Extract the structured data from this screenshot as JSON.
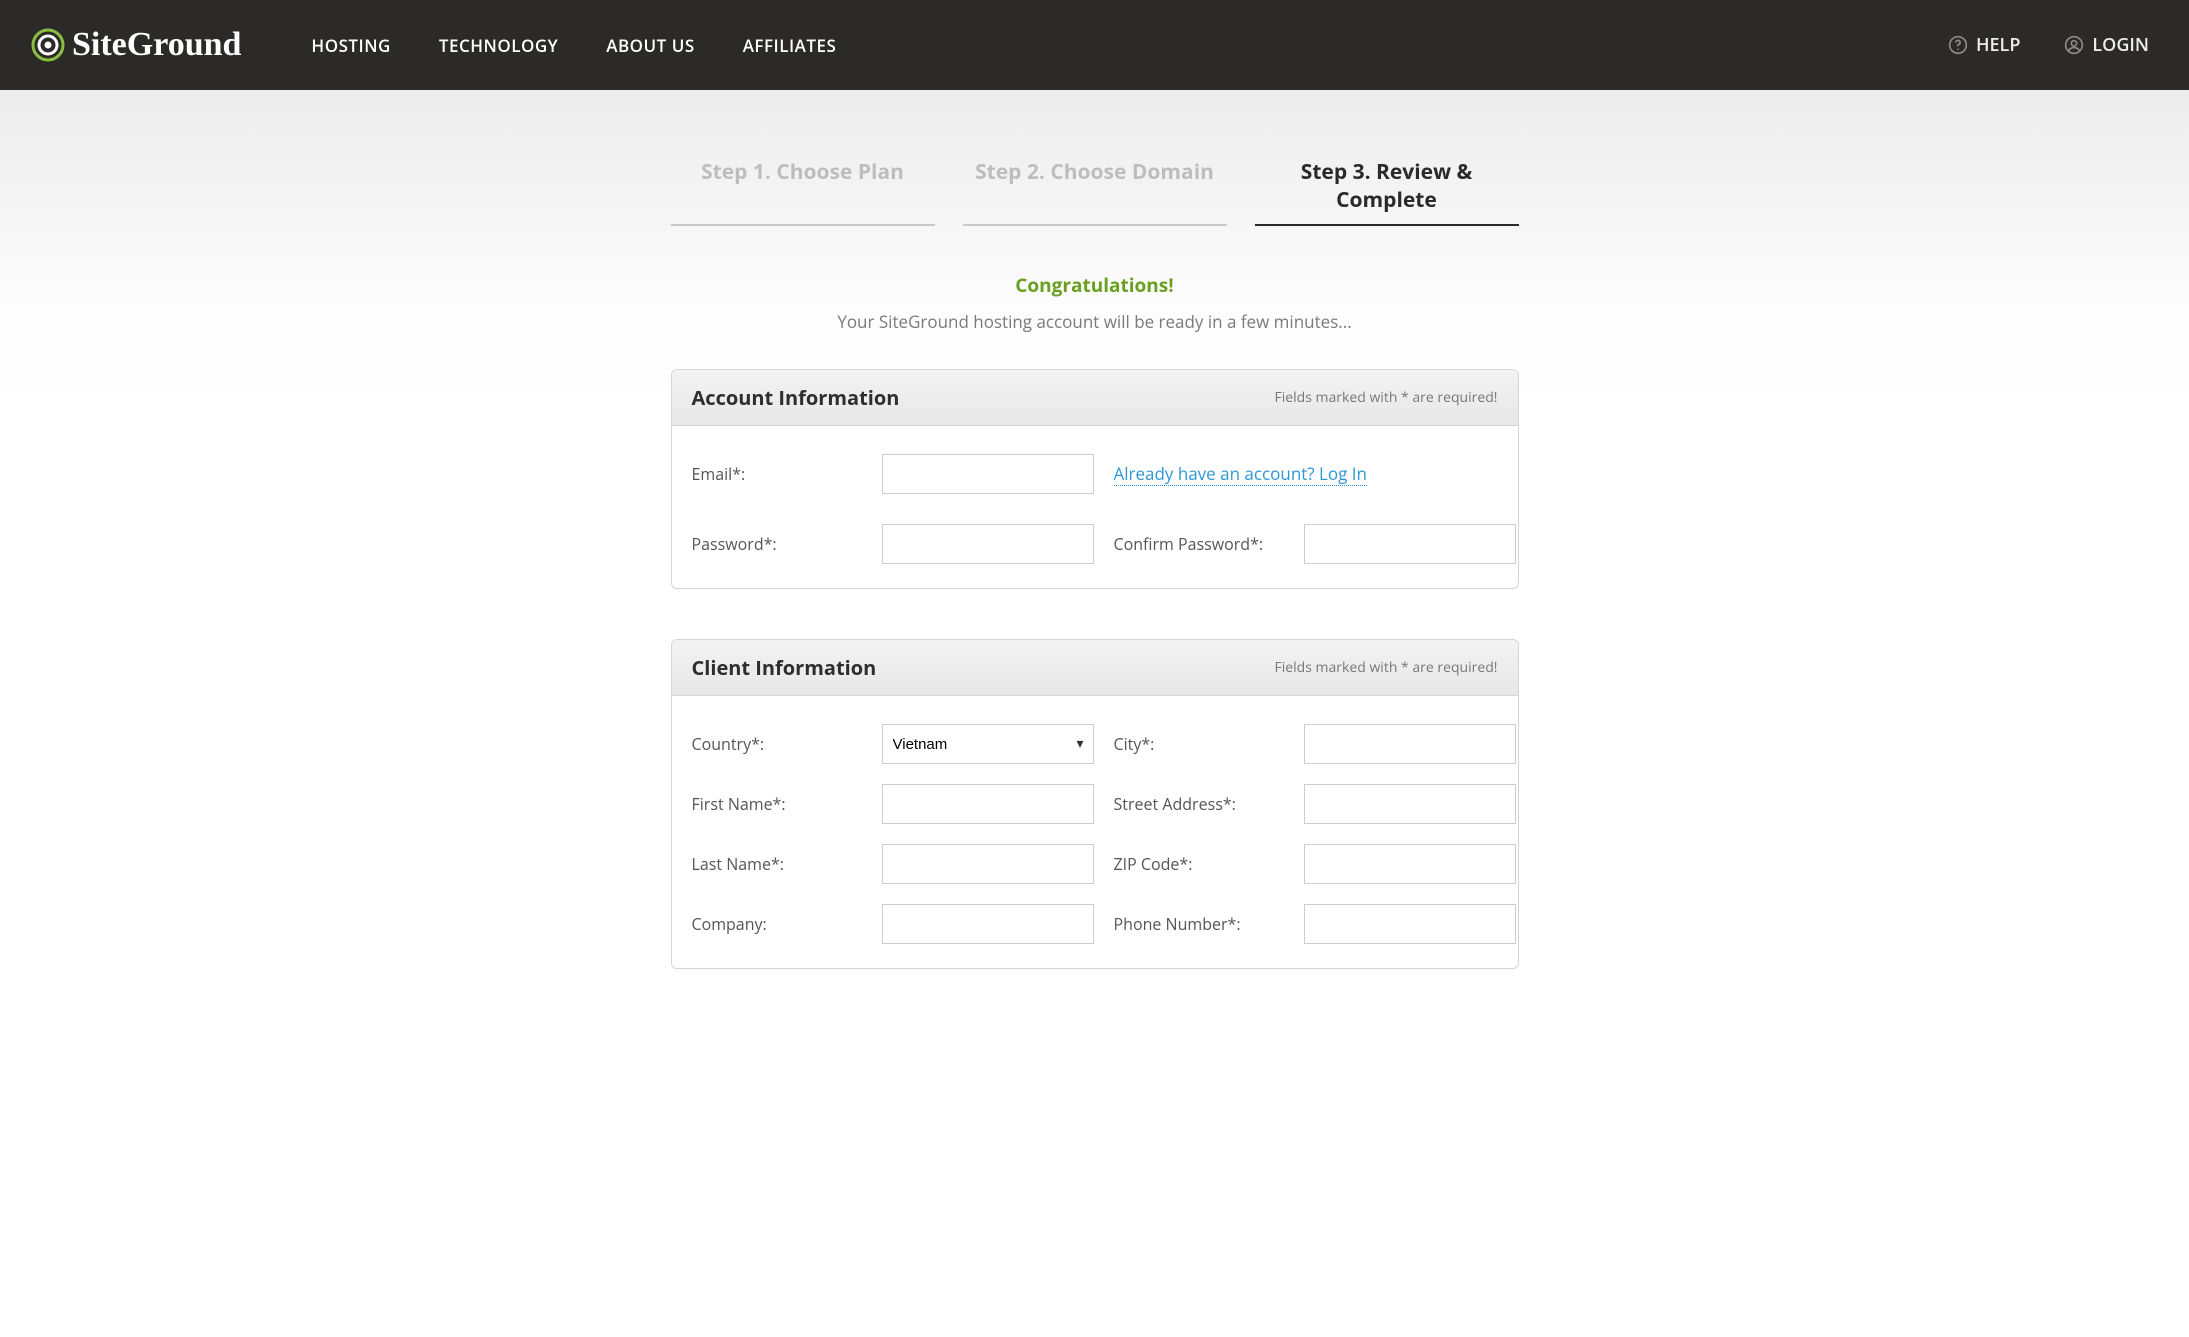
{
  "brand": {
    "name": "SiteGround"
  },
  "nav": {
    "hosting": "HOSTING",
    "technology": "TECHNOLOGY",
    "about": "ABOUT US",
    "affiliates": "AFFILIATES"
  },
  "header_right": {
    "help": "HELP",
    "login": "LOGIN"
  },
  "steps": {
    "s1": "Step 1. Choose Plan",
    "s2": "Step 2. Choose Domain",
    "s3": "Step 3. Review & Complete"
  },
  "messages": {
    "congrats": "Congratulations!",
    "subhead": "Your SiteGround hosting account will be ready in a few minutes..."
  },
  "required_note": "Fields marked with * are required!",
  "account": {
    "title": "Account Information",
    "email_label": "Email*:",
    "password_label": "Password*:",
    "confirm_label": "Confirm Password*:",
    "login_link": "Already have an account? Log In"
  },
  "client": {
    "title": "Client Information",
    "country_label": "Country*:",
    "country_value": "Vietnam",
    "city_label": "City*:",
    "first_name_label": "First Name*:",
    "street_label": "Street Address*:",
    "last_name_label": "Last Name*:",
    "zip_label": "ZIP Code*:",
    "company_label": "Company:",
    "phone_label": "Phone Number*:"
  }
}
